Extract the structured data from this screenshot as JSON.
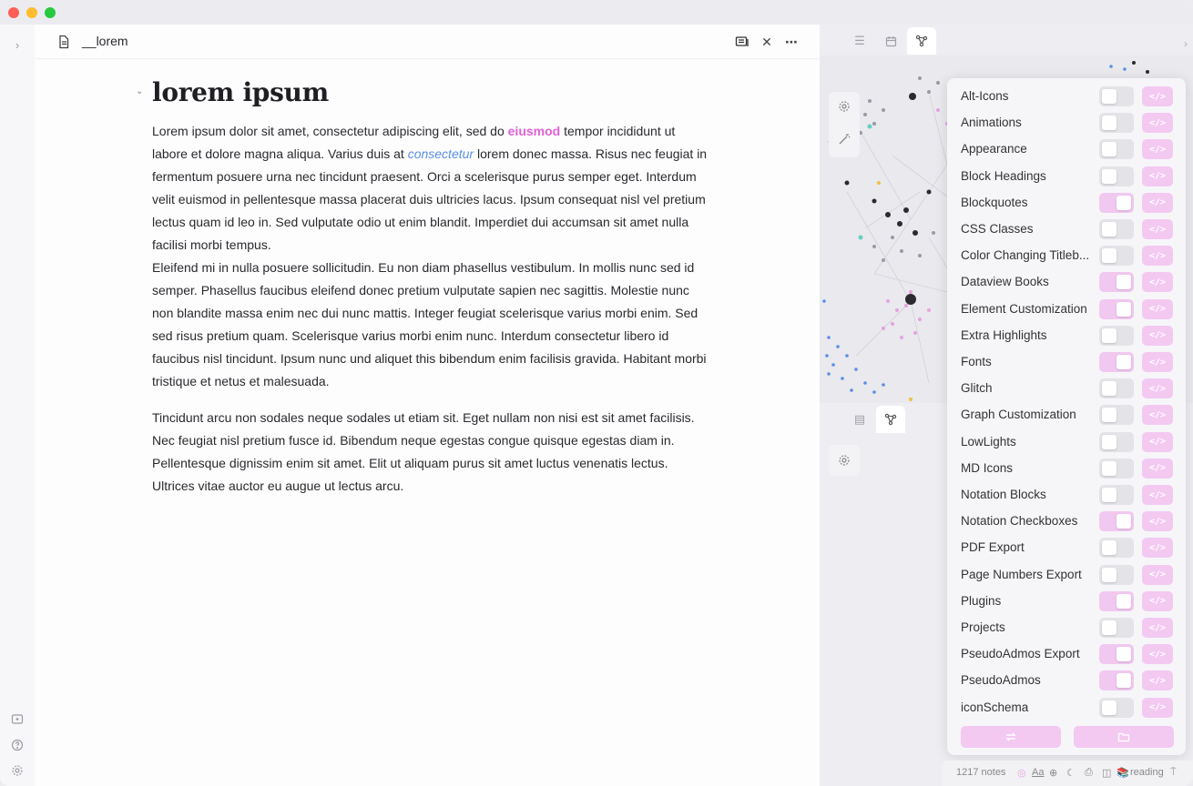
{
  "window": {
    "file_name": "__lorem"
  },
  "header": {
    "reading_view_icon": "book-icon",
    "close_label": "✕",
    "more_label": "⋯"
  },
  "document": {
    "heading": "lorem ipsum",
    "p1_a": "Lorem ipsum dolor sit amet, consectetur adipiscing elit, sed do ",
    "p1_highlight": "eiusmod",
    "p1_b": " tempor incididunt ut labore et dolore magna aliqua. Varius duis at ",
    "p1_em": "consectetur",
    "p1_c": " lorem donec massa. Risus nec feugiat in fermentum posuere urna nec tincidunt praesent. Orci a scelerisque purus semper eget. Interdum velit euismod in pellentesque massa placerat duis ultricies lacus. Ipsum consequat nisl vel pretium lectus quam id leo in. Sed vulputate odio ut enim blandit. Imperdiet dui accumsan sit amet nulla facilisi morbi tempus.",
    "p1_d": "Eleifend mi in nulla posuere sollicitudin. Eu non diam phasellus vestibulum. In mollis nunc sed id semper. Phasellus faucibus eleifend donec pretium vulputate sapien nec sagittis. Molestie nunc non blandite massa enim nec dui nunc mattis. Integer feugiat scelerisque varius morbi enim. Sed sed risus pretium quam. Scelerisque varius morbi enim nunc. Interdum consectetur libero id faucibus nisl tincidunt. Ipsum nunc und aliquet this bibendum enim facilisis gravida. Habitant morbi tristique et netus et malesuada.",
    "p2": "Tincidunt arcu non sodales neque sodales ut etiam sit. Eget nullam non nisi est sit amet facilisis. Nec feugiat nisl pretium fusce id. Bibendum neque egestas congue quisque egestas diam in. Pellentesque dignissim enim sit amet. Elit ut aliquam purus sit amet luctus venenatis lectus. Ultrices vitae auctor eu augue ut lectus arcu."
  },
  "colors": {
    "highlight": "#e062d8",
    "emphasis": "#5b8ee6",
    "toggle_on": "#f1c8f0",
    "accent": "#f3c9f2"
  },
  "snippets": [
    {
      "label": "Alt-Icons",
      "enabled": false
    },
    {
      "label": "Animations",
      "enabled": false
    },
    {
      "label": "Appearance",
      "enabled": false
    },
    {
      "label": "Block Headings",
      "enabled": false
    },
    {
      "label": "Blockquotes",
      "enabled": true
    },
    {
      "label": "CSS Classes",
      "enabled": false
    },
    {
      "label": "Color Changing Titleb...",
      "enabled": false
    },
    {
      "label": "Dataview Books",
      "enabled": true
    },
    {
      "label": "Element Customization",
      "enabled": true
    },
    {
      "label": "Extra Highlights",
      "enabled": false
    },
    {
      "label": "Fonts",
      "enabled": true
    },
    {
      "label": "Glitch",
      "enabled": false
    },
    {
      "label": "Graph Customization",
      "enabled": false
    },
    {
      "label": "LowLights",
      "enabled": false
    },
    {
      "label": "MD Icons",
      "enabled": false
    },
    {
      "label": "Notation Blocks",
      "enabled": false
    },
    {
      "label": "Notation Checkboxes",
      "enabled": true
    },
    {
      "label": "PDF Export",
      "enabled": false
    },
    {
      "label": "Page Numbers Export",
      "enabled": false
    },
    {
      "label": "Plugins",
      "enabled": true
    },
    {
      "label": "Projects",
      "enabled": false
    },
    {
      "label": "PseudoAdmos Export",
      "enabled": true
    },
    {
      "label": "PseudoAdmos",
      "enabled": true
    },
    {
      "label": "iconSchema",
      "enabled": false
    }
  ],
  "code_button_label": "</>",
  "statusbar": {
    "notes": "1217 notes",
    "font_label": "Aa",
    "mode": "reading"
  }
}
